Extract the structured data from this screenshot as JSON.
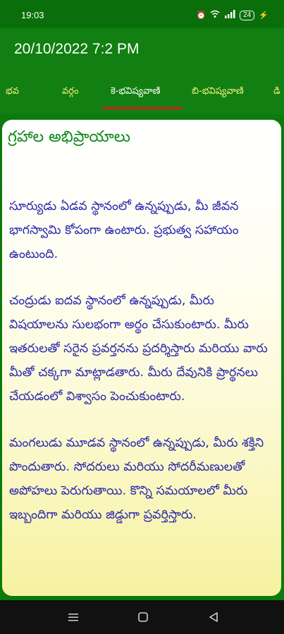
{
  "status": {
    "time": "19:03",
    "battery": "24"
  },
  "header": {
    "title": "20/10/2022 7:2 PM"
  },
  "tabs": [
    {
      "label": "భవ"
    },
    {
      "label": "వర్గం"
    },
    {
      "label": "కె-భవిష్యవాణి"
    },
    {
      "label": "బి-భవిష్యవాణి"
    },
    {
      "label": "డి"
    }
  ],
  "content": {
    "title": "గ్రహాల అభిప్రాయాలు",
    "paragraphs": [
      "సూర్యుడు ఏడవ స్థానంలో ఉన్నప్పుడు, మీ జీవన భాగస్వామి కోపంగా ఉంటారు. ప్రభుత్వ సహాయం ఉంటుంది.",
      "చంద్రుడు ఐదవ స్థానంలో ఉన్నప్పుడు, మీరు విషయాలను సులభంగా అర్థం చేసుకుంటారు. మీరు ఇతరులతో సరైన ప్రవర్తనను ప్రదర్శిస్తారు మరియు వారు మీతో చక్కగా మాట్లాడతారు. మీరు దేవునికి ప్రార్థనలు చేయడంలో విశ్వాసం పెంచుకుంటారు.",
      "మంగలుడు మూడవ స్థానంలో ఉన్నప్పుడు, మీరు శక్తిని పొందుతారు. సోదరులు మరియు సోదరీమణులతో అపోహలు పెరుగుతాయి. కొన్ని సమయాలలో మీరు ఇబ్బందిగా మరియు జిడ్డుగా ప్రవర్తిస్తారు."
    ]
  },
  "colors": {
    "header_green": "#117f11",
    "tab_text": "#f5ef7a",
    "tab_indicator": "#d51a1a",
    "title_green": "#0d8a18",
    "body_blue": "#2a2ab0"
  }
}
